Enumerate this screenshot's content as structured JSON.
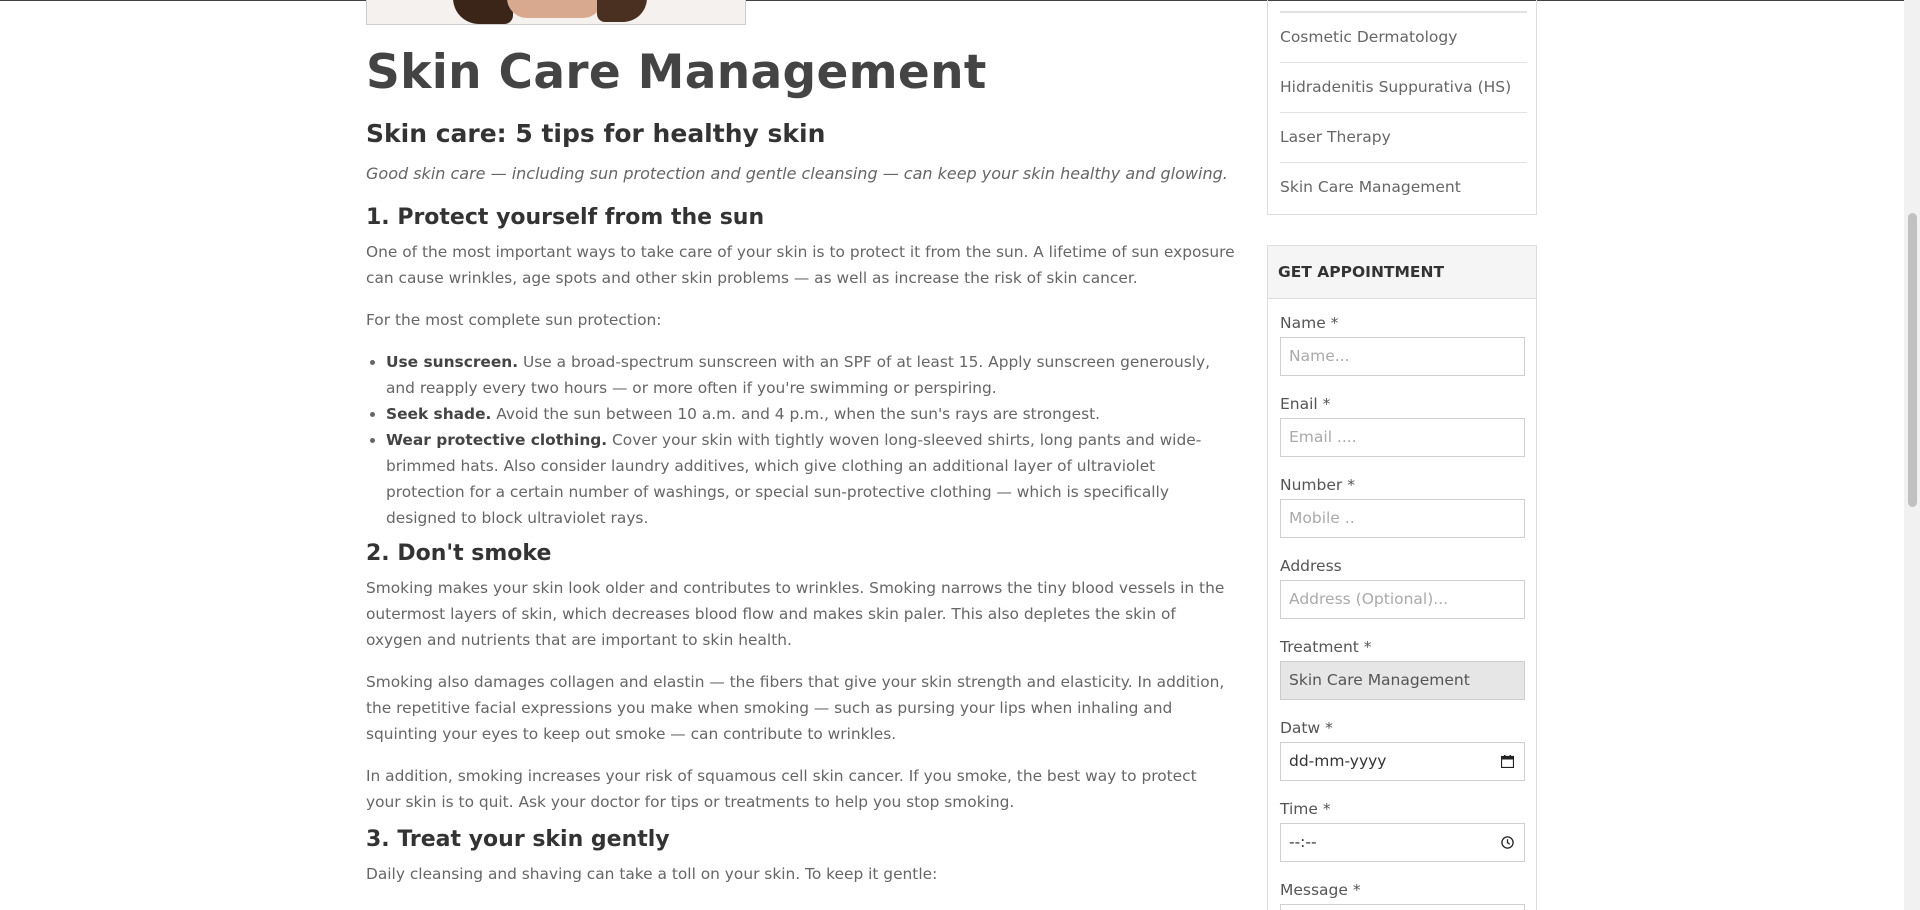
{
  "page": {
    "title": "Skin Care Management",
    "subtitle": "Skin care: 5 tips for healthy skin",
    "lead": "Good skin care — including sun protection and gentle cleansing — can keep your skin healthy and glowing."
  },
  "sections": {
    "s1": {
      "heading": "1. Protect yourself from the sun",
      "p1": "One of the most important ways to take care of your skin is to protect it from the sun. A lifetime of sun exposure can cause wrinkles, age spots and other skin problems — as well as increase the risk of skin cancer.",
      "p2": "For the most complete sun protection:",
      "tips": [
        {
          "bold": "Use sunscreen.",
          "text": " Use a broad-spectrum sunscreen with an SPF of at least 15. Apply sunscreen generously, and reapply every two hours — or more often if you're swimming or perspiring."
        },
        {
          "bold": "Seek shade.",
          "text": " Avoid the sun between 10 a.m. and 4 p.m., when the sun's rays are strongest."
        },
        {
          "bold": "Wear protective clothing.",
          "text": " Cover your skin with tightly woven long-sleeved shirts, long pants and wide-brimmed hats. Also consider laundry additives, which give clothing an additional layer of ultraviolet protection for a certain number of washings, or special sun-protective clothing — which is specifically designed to block ultraviolet rays."
        }
      ]
    },
    "s2": {
      "heading": "2. Don't smoke",
      "p1": "Smoking makes your skin look older and contributes to wrinkles. Smoking narrows the tiny blood vessels in the outermost layers of skin, which decreases blood flow and makes skin paler. This also depletes the skin of oxygen and nutrients that are important to skin health.",
      "p2": "Smoking also damages collagen and elastin — the fibers that give your skin strength and elasticity. In addition, the repetitive facial expressions you make when smoking — such as pursing your lips when inhaling and squinting your eyes to keep out smoke — can contribute to wrinkles.",
      "p3": "In addition, smoking increases your risk of squamous cell skin cancer. If you smoke, the best way to protect your skin is to quit. Ask your doctor for tips or treatments to help you stop smoking."
    },
    "s3": {
      "heading": "3. Treat your skin gently",
      "p1": "Daily cleansing and shaving can take a toll on your skin. To keep it gentle:"
    }
  },
  "sidebar": {
    "categories": [
      "Cosmetic Dermatology",
      "Hidradenitis Suppurativa (HS)",
      "Laser Therapy",
      "Skin Care Management"
    ],
    "appointment": {
      "heading": "GET APPOINTMENT",
      "name_label": "Name *",
      "name_placeholder": "Name...",
      "email_label": "Enail *",
      "email_placeholder": "Email ....",
      "number_label": "Number *",
      "number_placeholder": "Mobile ..",
      "address_label": "Address",
      "address_placeholder": "Address (Optional)...",
      "treatment_label": "Treatment *",
      "treatment_value": "Skin Care Management",
      "date_label": "Datw *",
      "date_value": "dd-mm-yyyy",
      "time_label": "Time *",
      "time_value": "--:--",
      "message_label": "Message *"
    }
  },
  "icons": {
    "date": "calendar-icon",
    "time": "clock-icon"
  }
}
